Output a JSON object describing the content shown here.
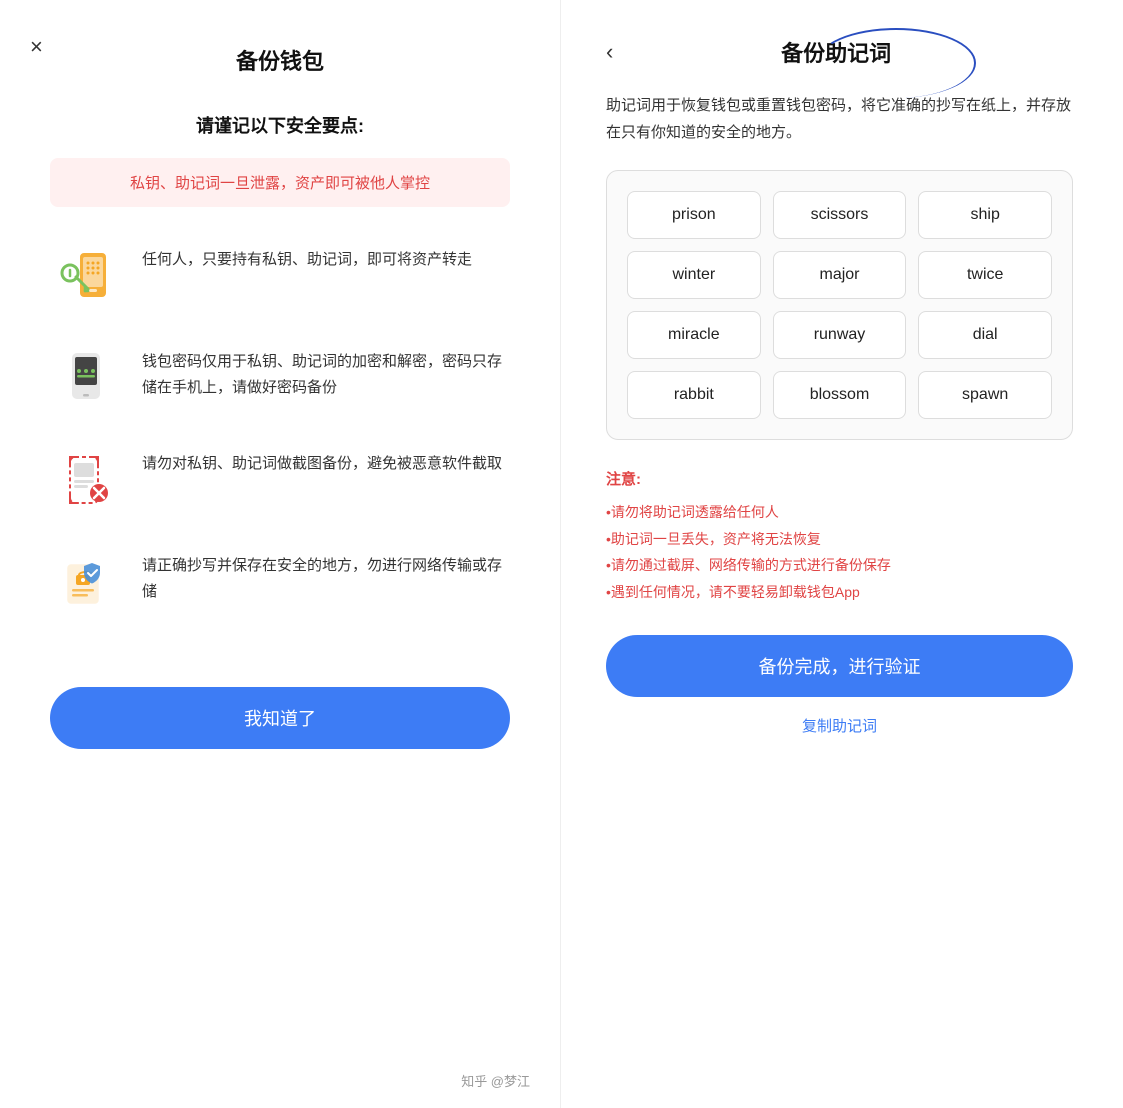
{
  "left": {
    "close_icon": "×",
    "title": "备份钱包",
    "security_heading": "请谨记以下安全要点:",
    "warning_text": "私钥、助记词一旦泄露，资产即可被他人掌控",
    "items": [
      {
        "text": "任何人，只要持有私钥、助记词，即可将资产转走"
      },
      {
        "text": "钱包密码仅用于私钥、助记词的加密和解密，密码只存储在手机上，请做好密码备份"
      },
      {
        "text": "请勿对私钥、助记词做截图备份，避免被恶意软件截取"
      },
      {
        "text": "请正确抄写并保存在安全的地方，勿进行网络传输或存储"
      }
    ],
    "confirm_button": "我知道了"
  },
  "right": {
    "back_icon": "‹",
    "title": "备份助记词",
    "description": "助记词用于恢复钱包或重置钱包密码，将它准确的抄写在纸上，并存放在只有你知道的安全的地方。",
    "mnemonic_words": [
      "prison",
      "scissors",
      "ship",
      "winter",
      "major",
      "twice",
      "miracle",
      "runway",
      "dial",
      "rabbit",
      "blossom",
      "spawn"
    ],
    "notice_title": "注意:",
    "notice_items": [
      "•请勿将助记词透露给任何人",
      "•助记词一旦丢失，资产将无法恢复",
      "•请勿通过截屏、网络传输的方式进行备份保存",
      "•遇到任何情况，请不要轻易卸载钱包App"
    ],
    "verify_button": "备份完成，进行验证",
    "copy_link": "复制助记词"
  },
  "watermark": "知乎 @梦江"
}
